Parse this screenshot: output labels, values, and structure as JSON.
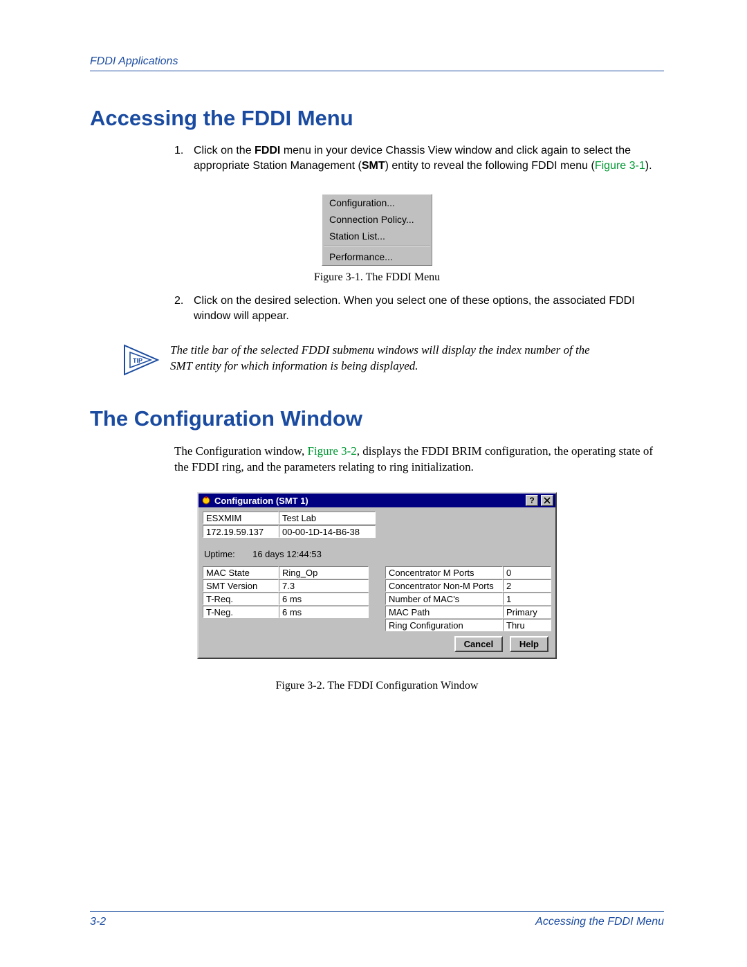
{
  "header": {
    "chapter": "FDDI Applications"
  },
  "section1": {
    "title": "Accessing the FDDI Menu",
    "step1_pre": "Click on the ",
    "step1_bold1": "FDDI",
    "step1_mid": " menu in your device Chassis View window and click again to select the appropriate Station Management (",
    "step1_bold2": "SMT",
    "step1_post": ") entity to reveal the following FDDI menu (",
    "step1_link": "Figure 3-1",
    "step1_end": ").",
    "menu": {
      "items": [
        "Configuration...",
        "Connection Policy...",
        "Station List..."
      ],
      "last": "Performance..."
    },
    "fig1_caption": "Figure 3-1. The FDDI Menu",
    "step2": "Click on the desired selection. When you select one of these options, the associated FDDI window will appear.",
    "tip": "The title bar of the selected FDDI submenu windows will display the index number of the SMT entity for which information is being displayed."
  },
  "tip_label": "TIP",
  "section2": {
    "title": "The Configuration Window",
    "para_pre": "The Configuration window, ",
    "para_link": "Figure 3-2",
    "para_post": ", displays the FDDI BRIM configuration, the operating state of the FDDI ring, and the parameters relating to ring initialization.",
    "fig2_caption": "Figure 3-2. The FDDI Configuration Window"
  },
  "config": {
    "title": "Configuration (SMT 1)",
    "row1": {
      "a": "ESXMIM",
      "b": "Test Lab"
    },
    "row2": {
      "a": "172.19.59.137",
      "b": "00-00-1D-14-B6-38"
    },
    "uptime_label": "Uptime:",
    "uptime_value": "16 days 12:44:53",
    "left": [
      {
        "k": "MAC State",
        "v": "Ring_Op"
      },
      {
        "k": "SMT Version",
        "v": "7.3"
      },
      {
        "k": "T-Req.",
        "v": "6 ms"
      },
      {
        "k": "T-Neg.",
        "v": "6 ms"
      }
    ],
    "right": [
      {
        "k": "Concentrator M Ports",
        "v": "0"
      },
      {
        "k": "Concentrator Non-M Ports",
        "v": "2"
      },
      {
        "k": "Number of MAC's",
        "v": "1"
      },
      {
        "k": "MAC Path",
        "v": "Primary"
      },
      {
        "k": "Ring Configuration",
        "v": "Thru"
      }
    ],
    "buttons": {
      "cancel": "Cancel",
      "help": "Help"
    }
  },
  "footer": {
    "page": "3-2",
    "section": "Accessing the FDDI Menu"
  },
  "list_numbers": {
    "one": "1.",
    "two": "2."
  }
}
